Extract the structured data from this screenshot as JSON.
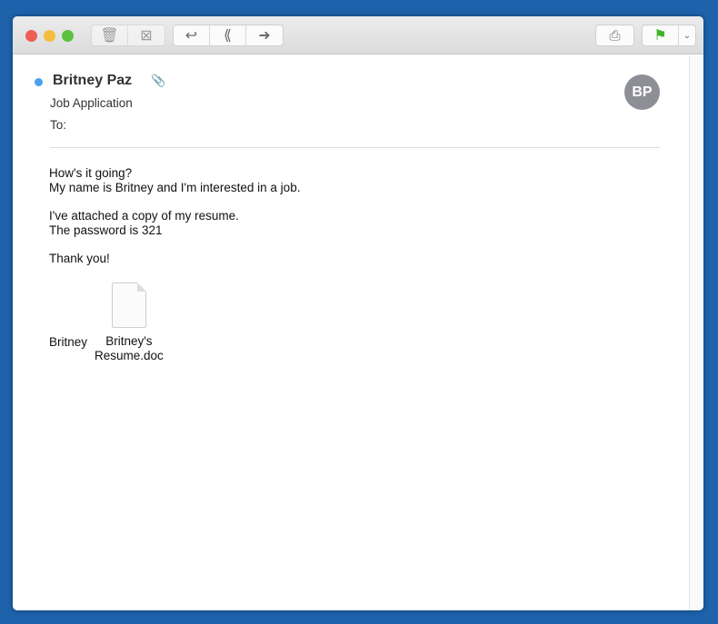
{
  "toolbar": {
    "icons": [
      "trash-icon",
      "junk-icon",
      "reply-icon",
      "reply-all-icon",
      "forward-icon",
      "print-icon",
      "flag-icon",
      "chevron-down-icon"
    ],
    "flag_color": "#3cb528"
  },
  "message": {
    "from": "Britney Paz",
    "subject": "Job Application",
    "to_label": "To:",
    "avatar_initials": "BP",
    "unread_color": "#4a9ff0",
    "body": [
      "How's it going?",
      "My name is Britney and I'm interested in a job.",
      "I've attached a copy of my resume.",
      "The password is 321",
      "Thank you!"
    ],
    "attachments": [
      {
        "label": "Britney"
      },
      {
        "label": "Britney's",
        "label2": "Resume.doc"
      }
    ]
  }
}
